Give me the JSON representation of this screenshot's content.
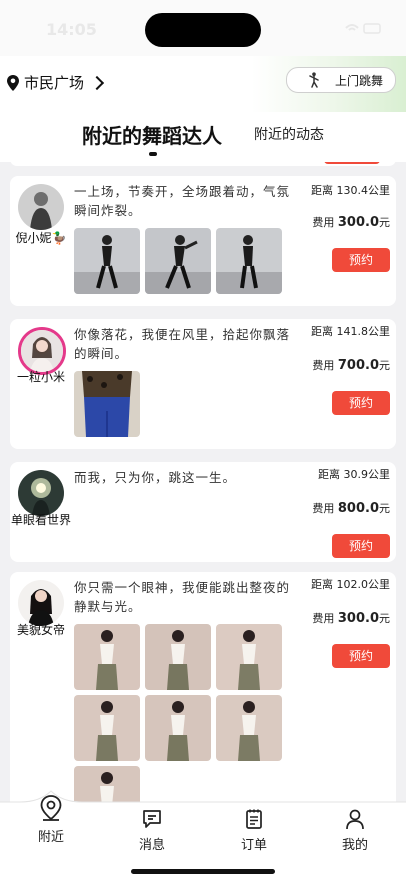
{
  "status": {
    "time": "14:05",
    "right_icons": "wifi-icon battery-icon"
  },
  "topbar": {
    "location": "市民广场",
    "service_button": "上门跳舞"
  },
  "tabs": {
    "main": "附近的舞蹈达人",
    "second": "附近的动态"
  },
  "cards": [
    {
      "name": "倪小妮🦆",
      "bio": "一上场，节奏开，全场跟着动，气氛瞬间炸裂。",
      "distance": "距离 130.4公里",
      "fee_label": "费用",
      "fee": "300.0",
      "fee_unit": "元",
      "book": "预约"
    },
    {
      "name": "一粒小米",
      "bio": "你像落花，我便在风里，拾起你飘落的瞬间。",
      "distance": "距离 141.8公里",
      "fee_label": "费用",
      "fee": "700.0",
      "fee_unit": "元",
      "book": "预约"
    },
    {
      "name": "单眼看世界",
      "bio": "而我，只为你，跳这一生。",
      "distance": "距离 30.9公里",
      "fee_label": "费用",
      "fee": "800.0",
      "fee_unit": "元",
      "book": "预约"
    },
    {
      "name": "美貌女帝",
      "bio": "你只需一个眼神，我便能跳出整夜的静默与光。",
      "distance": "距离 102.0公里",
      "fee_label": "费用",
      "fee": "300.0",
      "fee_unit": "元",
      "book": "预约"
    }
  ],
  "nav": [
    {
      "label": "附近",
      "icon": "location-pin-icon"
    },
    {
      "label": "消息",
      "icon": "message-icon"
    },
    {
      "label": "订单",
      "icon": "order-icon"
    },
    {
      "label": "我的",
      "icon": "user-icon"
    }
  ],
  "colors": {
    "accent": "#f04a3a",
    "avatar_ring": "#e4398a"
  }
}
